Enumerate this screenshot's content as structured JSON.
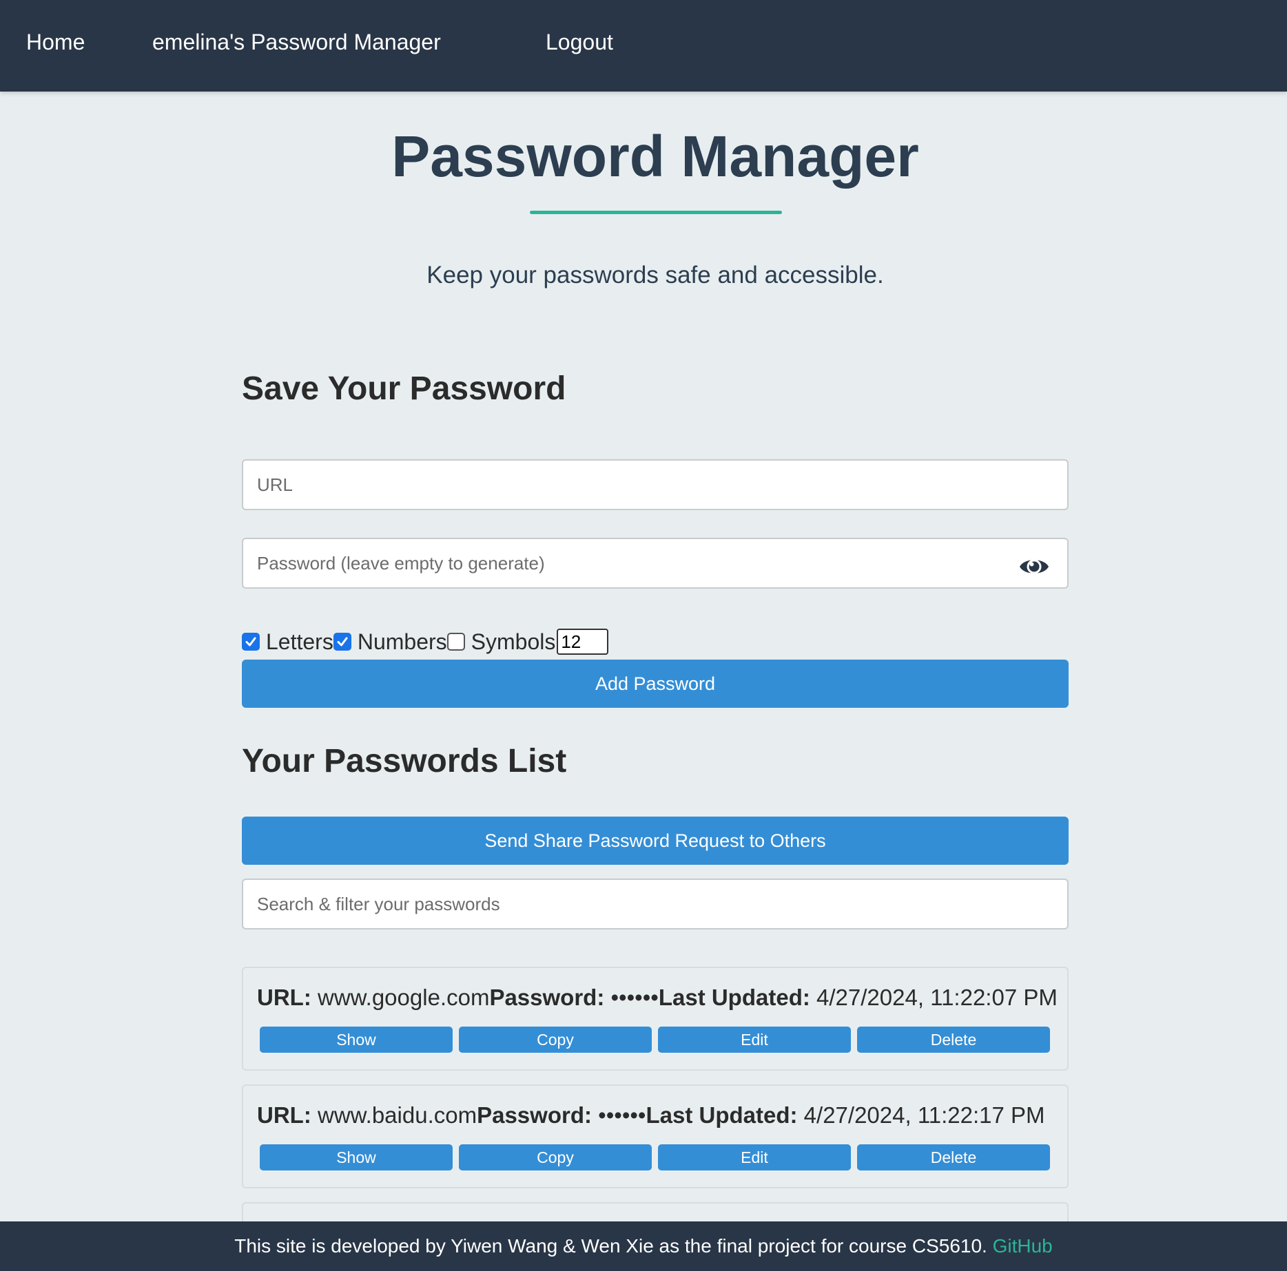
{
  "navbar": {
    "home": "Home",
    "app_name": "emelina's Password Manager",
    "logout": "Logout"
  },
  "hero": {
    "title": "Password Manager",
    "subtitle": "Keep your passwords safe and accessible.",
    "accent_color": "#2bb596"
  },
  "save_section": {
    "heading": "Save Your Password",
    "url_placeholder": "URL",
    "url_value": "",
    "password_placeholder": "Password (leave empty to generate)",
    "password_value": "",
    "visibility_icon": "eye-icon",
    "options": [
      {
        "label": "Letters",
        "checked": true
      },
      {
        "label": "Numbers",
        "checked": true
      },
      {
        "label": "Symbols",
        "checked": false
      }
    ],
    "length_value": "12",
    "add_button": "Add Password"
  },
  "list_section": {
    "heading": "Your Passwords List",
    "share_button": "Send Share Password Request to Others",
    "search_placeholder": "Search & filter your passwords",
    "search_value": "",
    "field_labels": {
      "url": "URL:",
      "password": "Password:",
      "last_updated": "Last Updated:"
    },
    "action_labels": [
      "Show",
      "Copy",
      "Edit",
      "Delete"
    ],
    "entries": [
      {
        "url": "www.google.com",
        "password": "••••••",
        "last_updated": "4/27/2024, 11:22:07 PM"
      },
      {
        "url": "www.baidu.com",
        "password": "••••••",
        "last_updated": "4/27/2024, 11:22:17 PM"
      }
    ]
  },
  "footer": {
    "text": "This site is developed by Yiwen Wang & Wen Xie as the final project for course CS5610.",
    "link": "GitHub"
  },
  "colors": {
    "navbar_bg": "#293647",
    "page_bg": "#e8eef0",
    "primary_button": "#348ed6",
    "checkbox_checked": "#1a73e8"
  }
}
